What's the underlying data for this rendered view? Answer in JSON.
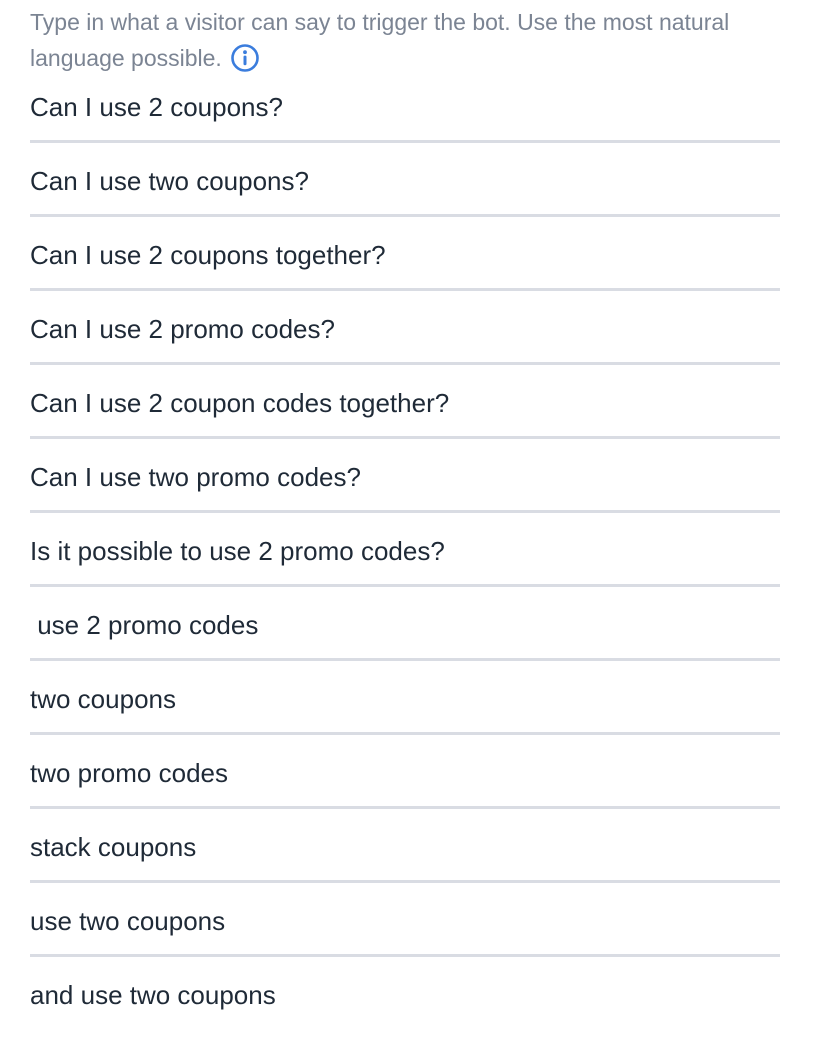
{
  "instructions": {
    "text": "Type in what a visitor can say to trigger the bot. Use the most natural language possible.",
    "info_icon": "info-circle-icon",
    "accent_color": "#3b7ddd"
  },
  "phrases": [
    "Can I use 2 coupons?",
    "Can I use two coupons?",
    "Can I use 2 coupons together?",
    "Can I use 2 promo codes?",
    "Can I use 2 coupon codes together?",
    "Can I use two promo codes?",
    "Is it possible to use 2 promo codes?",
    " use 2 promo codes",
    "two coupons",
    "two promo codes",
    "stack coupons",
    "use two coupons",
    "and use two coupons"
  ]
}
